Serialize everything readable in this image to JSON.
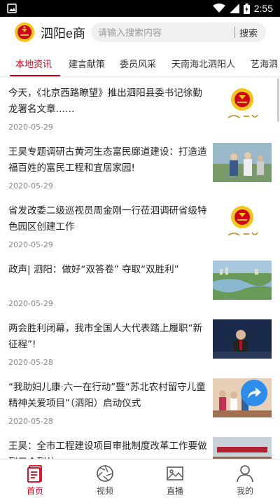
{
  "status_bar": {
    "time": "2:55"
  },
  "header": {
    "app_title": "泗阳e商",
    "search_placeholder": "请输入搜索内容",
    "search_button": "搜索"
  },
  "tabs": [
    {
      "label": "本地资讯",
      "active": true
    },
    {
      "label": "建言献策",
      "active": false
    },
    {
      "label": "委员风采",
      "active": false
    },
    {
      "label": "天南海北泗阳人",
      "active": false
    },
    {
      "label": "艺海泗",
      "active": false
    }
  ],
  "news": [
    {
      "title": "今天，《北京西路瞭望》推出泗阳县委书记徐勤龙署名文章……",
      "date": "2020-05-29",
      "thumb": "cppcc-emblem"
    },
    {
      "title": "王昊专题调研古黄河生态富民廊道建设：打造造福百姓的富民工程和宜居家园!",
      "date": "2020-05-29",
      "thumb": "photo-officials-field"
    },
    {
      "title": "省发改委二级巡视员周金刚一行莅泗调研省级特色园区创建工作",
      "date": "2020-05-29",
      "thumb": "cppcc-emblem"
    },
    {
      "title": "政声| 泗阳：做好“双答卷” 夺取“双胜利”",
      "date": "2020-05-29",
      "thumb": "photo-aerial-river"
    },
    {
      "title": "两会胜利闭幕，我市全国人大代表踏上履职“新征程”!",
      "date": "2020-05-28",
      "thumb": "photo-congress-speaker"
    },
    {
      "title": "“我助妇儿康·六一在行动”暨“苏北农村留守儿童精神关爱项目”（泗阳）启动仪式",
      "date": "2020-05-28",
      "thumb": "photo-children-event"
    },
    {
      "title": "王昊：全市工程建设项目审批制度改革工作要做到三个到位",
      "date": "",
      "thumb": "photo-meeting-hall"
    }
  ],
  "bottom_nav": [
    {
      "label": "首页",
      "icon": "home-doc-icon",
      "active": true
    },
    {
      "label": "视频",
      "icon": "camera-aperture-icon",
      "active": false
    },
    {
      "label": "直播",
      "icon": "image-icon",
      "active": false
    },
    {
      "label": "我的",
      "icon": "person-icon",
      "active": false
    }
  ],
  "colors": {
    "accent": "#d0021b",
    "fab": "#2e8de8"
  }
}
